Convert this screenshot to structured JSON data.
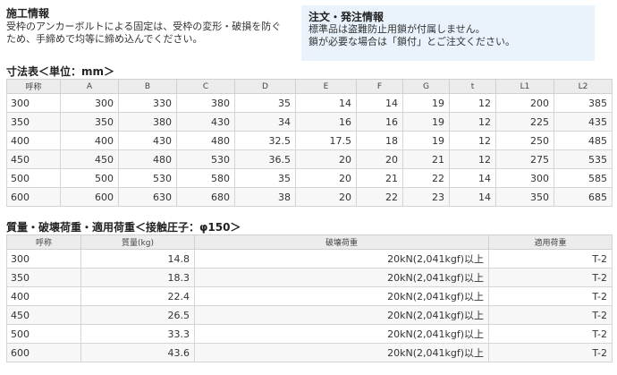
{
  "install": {
    "title": "施工情報",
    "line1": "受枠のアンカーボルトによる固定は、受枠の変形・破損を防ぐ",
    "line2": "ため、手締めで均等に締め込んでください。"
  },
  "order": {
    "title": "注文・発注情報",
    "line1": "標準品は盗難防止用鎖が付属しません。",
    "line2": "鎖が必要な場合は「鎖付」とご注文ください。"
  },
  "dimensions": {
    "title": "寸法表＜単位：mm＞",
    "headers": [
      "呼称",
      "A",
      "B",
      "C",
      "D",
      "E",
      "F",
      "G",
      "t",
      "L1",
      "L2"
    ],
    "rows": [
      [
        "300",
        "300",
        "330",
        "380",
        "35",
        "14",
        "14",
        "19",
        "12",
        "200",
        "385"
      ],
      [
        "350",
        "350",
        "380",
        "430",
        "34",
        "16",
        "16",
        "19",
        "12",
        "225",
        "435"
      ],
      [
        "400",
        "400",
        "430",
        "480",
        "32.5",
        "17.5",
        "18",
        "19",
        "12",
        "250",
        "485"
      ],
      [
        "450",
        "450",
        "480",
        "530",
        "36.5",
        "20",
        "20",
        "21",
        "12",
        "275",
        "535"
      ],
      [
        "500",
        "500",
        "530",
        "580",
        "35",
        "20",
        "21",
        "22",
        "14",
        "300",
        "585"
      ],
      [
        "600",
        "600",
        "630",
        "680",
        "38",
        "20",
        "22",
        "23",
        "14",
        "350",
        "685"
      ]
    ]
  },
  "loads": {
    "title": "質量・破壊荷重・適用荷重＜接触圧子：φ150＞",
    "headers": [
      "呼称",
      "質量(kg)",
      "破壊荷重",
      "適用荷重"
    ],
    "rows": [
      [
        "300",
        "14.8",
        "20kN(2,041kgf)以上",
        "T-2"
      ],
      [
        "350",
        "18.3",
        "20kN(2,041kgf)以上",
        "T-2"
      ],
      [
        "400",
        "22.4",
        "20kN(2,041kgf)以上",
        "T-2"
      ],
      [
        "450",
        "26.5",
        "20kN(2,041kgf)以上",
        "T-2"
      ],
      [
        "500",
        "33.3",
        "20kN(2,041kgf)以上",
        "T-2"
      ],
      [
        "600",
        "43.6",
        "20kN(2,041kgf)以上",
        "T-2"
      ]
    ]
  }
}
